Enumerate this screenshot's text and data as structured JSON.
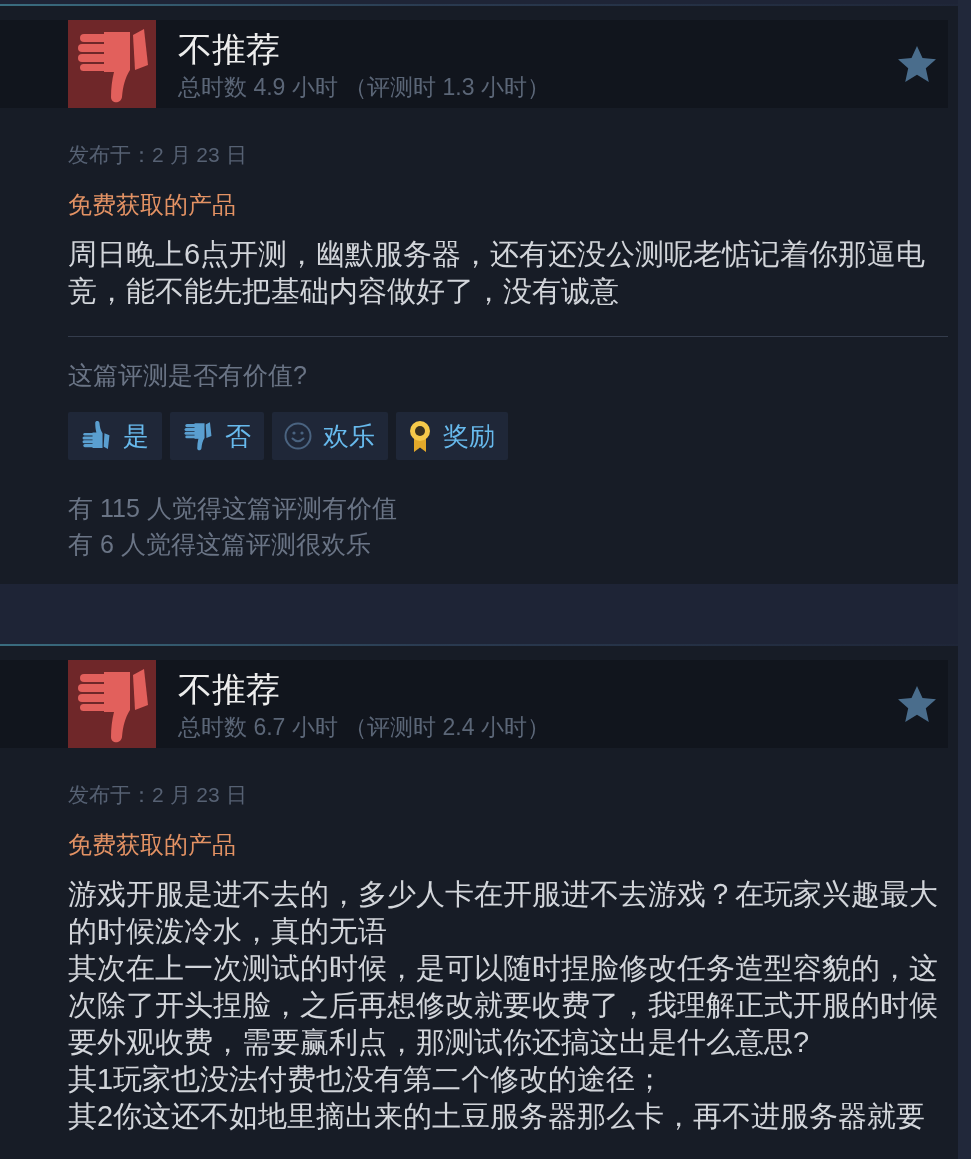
{
  "reviews": [
    {
      "verdict": "不推荐",
      "recommended": false,
      "hours": "总时数 4.9 小时 （评测时 1.3 小时）",
      "posted": "发布于：2 月 23 日",
      "badge": "免费获取的产品",
      "paragraphs": [
        "周日晚上6点开测，幽默服务器，还有还没公测呢老惦记着你那逼电竞，能不能先把基础内容做好了，没有诚意"
      ],
      "helpful_prompt": "这篇评测是否有价值?",
      "vote_buttons": [
        {
          "kind": "yes",
          "label": "是"
        },
        {
          "kind": "no",
          "label": "否"
        },
        {
          "kind": "funny",
          "label": "欢乐"
        },
        {
          "kind": "award",
          "label": "奖励"
        }
      ],
      "tallies": [
        "有 115 人觉得这篇评测有价值",
        "有 6 人觉得这篇评测很欢乐"
      ]
    },
    {
      "verdict": "不推荐",
      "recommended": false,
      "hours": "总时数 6.7 小时 （评测时 2.4 小时）",
      "posted": "发布于：2 月 23 日",
      "badge": "免费获取的产品",
      "paragraphs": [
        "游戏开服是进不去的，多少人卡在开服进不去游戏？在玩家兴趣最大的时候泼冷水，真的无语",
        "其次在上一次测试的时候，是可以随时捏脸修改任务造型容貌的，这次除了开头捏脸，之后再想修改就要收费了，我理解正式开服的时候要外观收费，需要赢利点，那测试你还搞这出是什么意思?",
        "其1玩家也没法付费也没有第二个修改的途径；",
        "其2你这还不如地里摘出来的土豆服务器那么卡，再不进服务器就要"
      ]
    }
  ]
}
